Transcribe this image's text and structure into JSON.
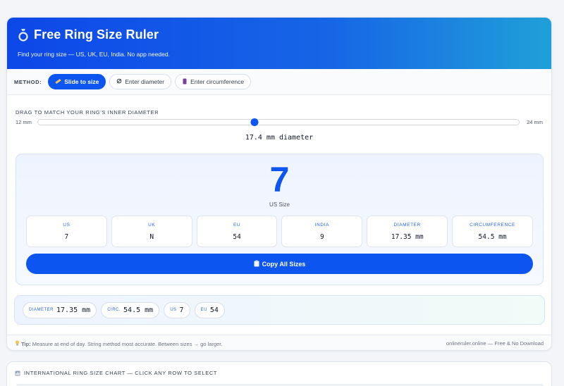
{
  "header": {
    "title": "Free Ring Size Ruler",
    "subtitle": "Find your ring size — US, UK, EU, India. No app needed."
  },
  "method": {
    "label": "METHOD:",
    "options": [
      {
        "label": "Slide to size",
        "icon": "ruler-icon",
        "active": true
      },
      {
        "label": "Enter diameter",
        "icon": "ring-diameter-icon",
        "active": false
      },
      {
        "label": "Enter circumference",
        "icon": "string-icon",
        "active": false
      }
    ]
  },
  "slider": {
    "label": "DRAG TO MATCH YOUR RING'S INNER DIAMETER",
    "min_label": "12 mm",
    "max_label": "24 mm",
    "min": 12,
    "max": 24,
    "value": 17.4,
    "readout": "17.4 mm diameter"
  },
  "result": {
    "size": "7",
    "size_label": "US Size",
    "cells": [
      {
        "label": "US",
        "value": "7"
      },
      {
        "label": "UK",
        "value": "N"
      },
      {
        "label": "EU",
        "value": "54"
      },
      {
        "label": "INDIA",
        "value": "9"
      },
      {
        "label": "DIAMETER",
        "value": "17.35 mm"
      },
      {
        "label": "CIRCUMFERENCE",
        "value": "54.5 mm"
      }
    ],
    "copy_label": "Copy All Sizes"
  },
  "chips": [
    {
      "label": "DIAMETER",
      "value": "17.35 mm"
    },
    {
      "label": "CIRC.",
      "value": "54.5 mm"
    },
    {
      "label": "US",
      "value": "7"
    },
    {
      "label": "EU",
      "value": "54"
    }
  ],
  "footer": {
    "tip_label": "Tip:",
    "tip_text": "Measure at end of day. String method most accurate. Between sizes → go larger.",
    "credit": "onlineruler.online — Free & No Download"
  },
  "chart_section": {
    "title": "INTERNATIONAL RING SIZE CHART — CLICK ANY ROW TO SELECT"
  },
  "colors": {
    "accent": "#0d55f0",
    "header_gradient_start": "#0d47e8",
    "header_gradient_end": "#1fa0d8"
  }
}
